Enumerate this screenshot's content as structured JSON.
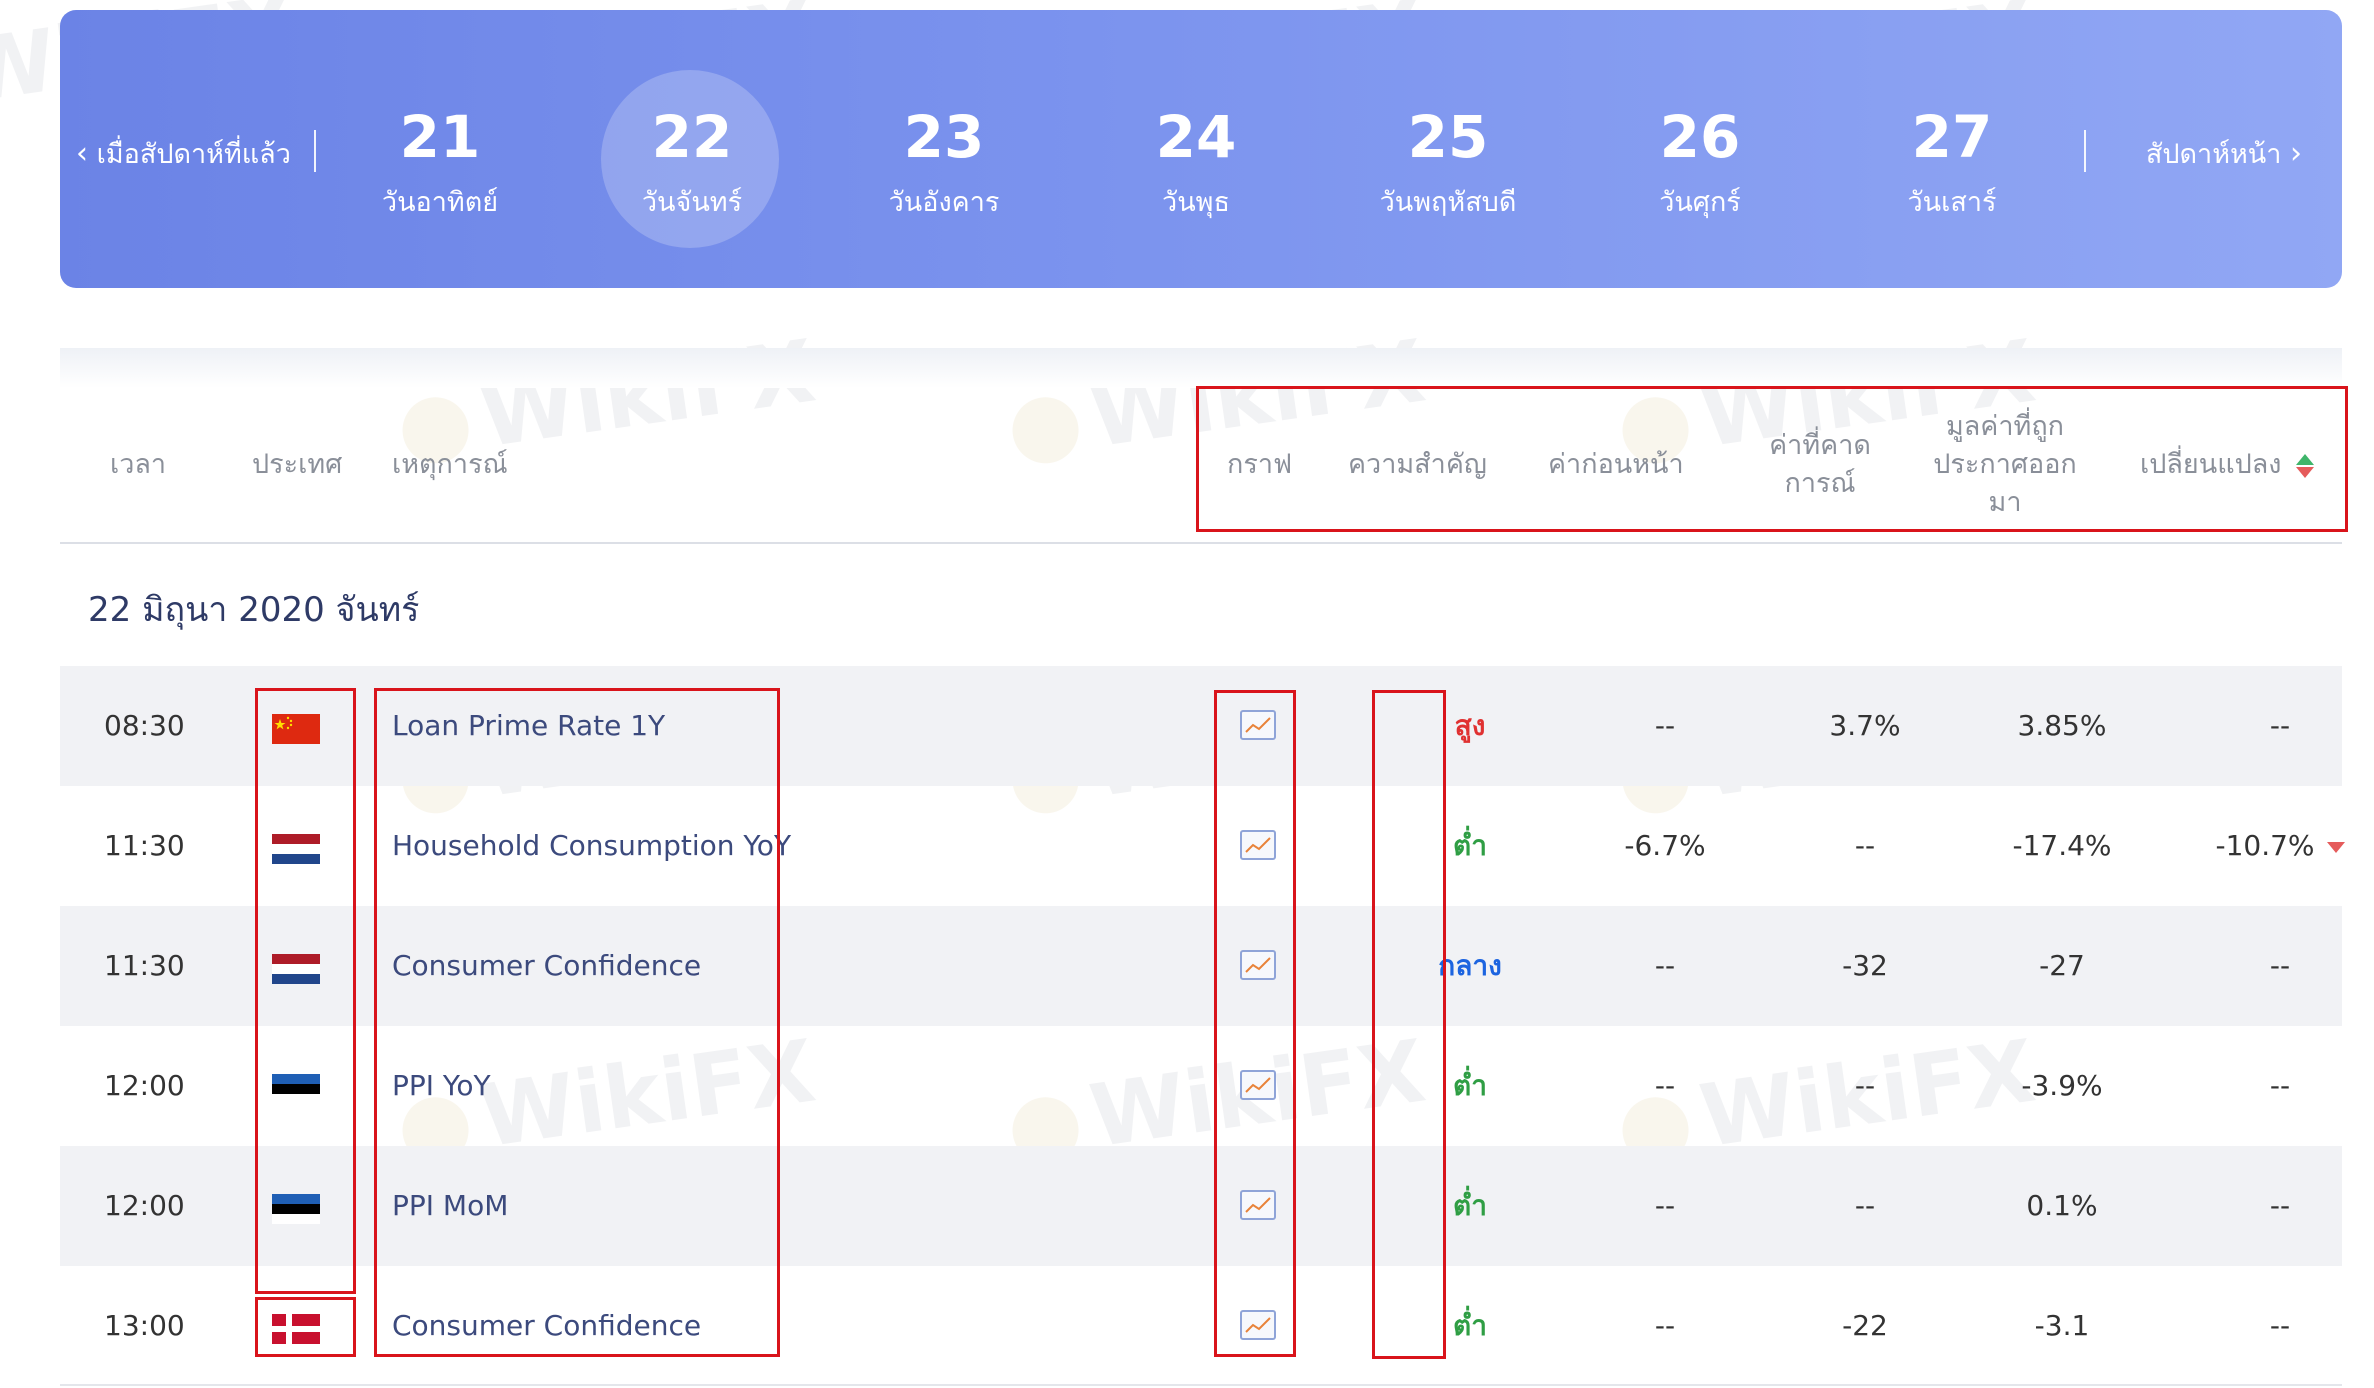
{
  "week_nav": {
    "prev_label": "เมื่อสัปดาห์ที่แล้ว",
    "next_label": "สัปดาห์หน้า",
    "days": [
      {
        "num": "21",
        "name": "วันอาทิตย์",
        "active": false
      },
      {
        "num": "22",
        "name": "วันจันทร์",
        "active": true
      },
      {
        "num": "23",
        "name": "วันอังคาร",
        "active": false
      },
      {
        "num": "24",
        "name": "วันพุธ",
        "active": false
      },
      {
        "num": "25",
        "name": "วันพฤหัสบดี",
        "active": false
      },
      {
        "num": "26",
        "name": "วันศุกร์",
        "active": false
      },
      {
        "num": "27",
        "name": "วันเสาร์",
        "active": false
      }
    ]
  },
  "columns": {
    "time": "เวลา",
    "country": "ประเทศ",
    "event": "เหตุการณ์",
    "chart": "กราฟ",
    "importance": "ความสำคัญ",
    "previous": "ค่าก่อนหน้า",
    "forecast_l1": "ค่าที่คาด",
    "forecast_l2": "การณ์",
    "actual_l1": "มูลค่าที่ถูก",
    "actual_l2": "ประกาศออก",
    "actual_l3": "มา",
    "change": "เปลี่ยนแปลง"
  },
  "date_title": "22 มิถุนา 2020 จันทร์",
  "rows": [
    {
      "time": "08:30",
      "country": "china-flag",
      "event": "Loan Prime Rate 1Y",
      "importance": "สูง",
      "importance_level": "high",
      "previous": "--",
      "forecast": "3.7%",
      "actual": "3.85%",
      "change": "--"
    },
    {
      "time": "11:30",
      "country": "netherlands-flag",
      "event": "Household Consumption YoY",
      "importance": "ต่ำ",
      "importance_level": "low",
      "previous": "-6.7%",
      "forecast": "--",
      "actual": "-17.4%",
      "change": "-10.7%"
    },
    {
      "time": "11:30",
      "country": "netherlands-flag",
      "event": "Consumer Confidence",
      "importance": "กลาง",
      "importance_level": "mid",
      "previous": "--",
      "forecast": "-32",
      "actual": "-27",
      "change": "--"
    },
    {
      "time": "12:00",
      "country": "estonia-flag",
      "event": "PPI YoY",
      "importance": "ต่ำ",
      "importance_level": "low",
      "previous": "--",
      "forecast": "--",
      "actual": "-3.9%",
      "change": "--"
    },
    {
      "time": "12:00",
      "country": "estonia-flag",
      "event": "PPI MoM",
      "importance": "ต่ำ",
      "importance_level": "low",
      "previous": "--",
      "forecast": "--",
      "actual": "0.1%",
      "change": "--"
    },
    {
      "time": "13:00",
      "country": "denmark-flag",
      "event": "Consumer Confidence",
      "importance": "ต่ำ",
      "importance_level": "low",
      "previous": "--",
      "forecast": "-22",
      "actual": "-3.1",
      "change": "--"
    }
  ],
  "watermark": "WikiFX",
  "colors": {
    "banner_start": "#6b83e6",
    "banner_end": "#91a7f4",
    "importance_high": "#e03131",
    "importance_low": "#2f9e44",
    "importance_mid": "#1c64e0",
    "highlight_box": "#d9141b"
  }
}
